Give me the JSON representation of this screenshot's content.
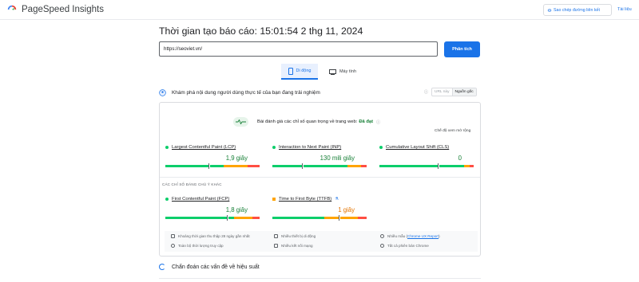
{
  "app": {
    "name": "PageSpeed Insights"
  },
  "header": {
    "copy_link": "Sao chép đường liên kết",
    "docs": "Tài liệu"
  },
  "report": {
    "title": "Thời gian tạo báo cáo: 15:01:54 2 thg 11, 2024"
  },
  "search": {
    "url": "https://seoviet.vn/",
    "analyze_label": "Phân tích"
  },
  "tabs": [
    {
      "label": "Di động",
      "active": true
    },
    {
      "label": "Máy tính",
      "active": false
    }
  ],
  "crux": {
    "heading": "Khám phá nội dung người dùng thực tế của bạn đang trải nghiệm",
    "seg_url": "URL này",
    "seg_origin": "Nguồn gốc",
    "assessment_prefix": "Bài đánh giá các chỉ số quan trọng về trang web:",
    "assessment_result": "Đã đạt",
    "expand": "Chế độ xem mở rộng",
    "core_metrics": [
      {
        "name": "Largest Contentful Paint (LCP)",
        "value": "1,9 giây",
        "status": "good",
        "distribution": [
          0.62,
          0.25,
          0.13
        ],
        "marker": 0.46
      },
      {
        "name": "Interaction to Next Paint (INP)",
        "value": "130 mili giây",
        "status": "good",
        "distribution": [
          0.8,
          0.14,
          0.06
        ],
        "marker": 0.31
      },
      {
        "name": "Cumulative Layout Shift (CLS)",
        "value": "0",
        "status": "good",
        "distribution": [
          0.9,
          0.06,
          0.04
        ],
        "marker": 0.62
      }
    ],
    "other_label": "CÁC CHỈ SỐ ĐÁNG CHÚ Ý KHÁC",
    "other_metrics": [
      {
        "name": "First Contentful Paint (FCP)",
        "value": "1,8 giây",
        "status": "good",
        "distribution": [
          0.73,
          0.19,
          0.08
        ],
        "marker": 0.65
      },
      {
        "name": "Time to First Byte (TTFB)",
        "value": "1 giây",
        "status": "average",
        "distribution": [
          0.55,
          0.36,
          0.09
        ],
        "marker": 0.7
      }
    ],
    "footer": {
      "period": "Khoảng thời gian thu thập 28 ngày gần nhất",
      "full_duration": "Toàn bộ thời lượng truy cập",
      "devices": "Nhiều thiết bị di động",
      "connections": "Nhiều kết nối mạng",
      "samples_prefix": "Nhiều mẫu",
      "samples_link": "Chrome UX Report",
      "chrome_versions": "Tất cả phiên bản Chrome"
    }
  },
  "diagnose": {
    "heading": "Chẩn đoán các vấn đề về hiệu suất"
  },
  "colors": {
    "good": "#0cce6b",
    "average": "#ffa400",
    "poor": "#ff4e42",
    "accent": "#1a73e8"
  }
}
